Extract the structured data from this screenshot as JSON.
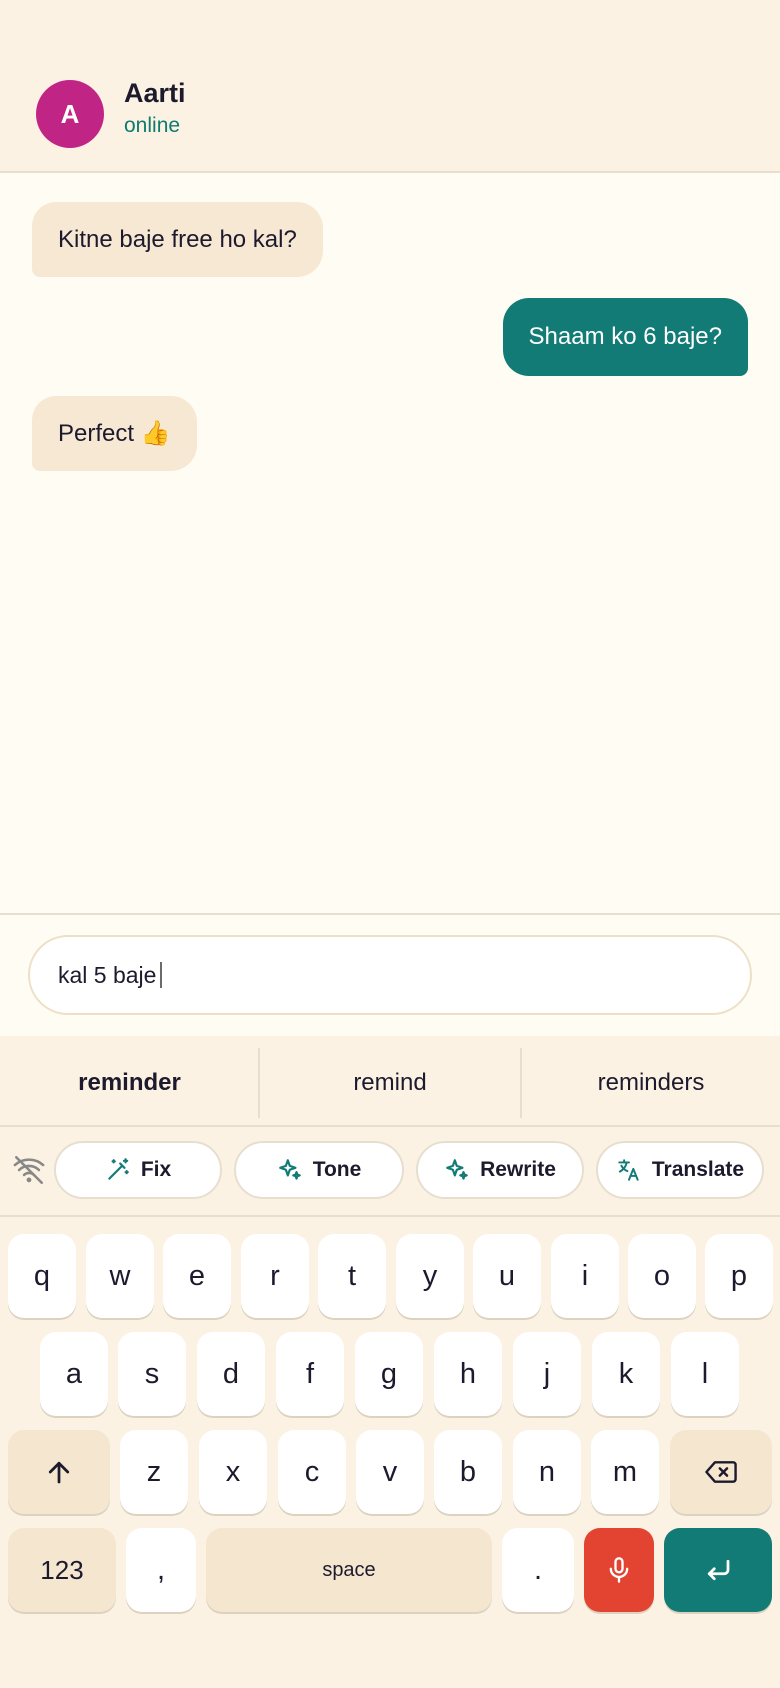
{
  "contact": {
    "initial": "A",
    "name": "Aarti",
    "status": "online"
  },
  "messages": [
    {
      "direction": "in",
      "text": "Kitne baje free ho kal?"
    },
    {
      "direction": "out",
      "text": "Shaam ko 6 baje?"
    },
    {
      "direction": "in",
      "text": "Perfect 👍"
    }
  ],
  "composer": {
    "value": "kal 5 baje"
  },
  "suggestions": [
    "reminder",
    "remind",
    "reminders"
  ],
  "tools": {
    "fix": "Fix",
    "tone": "Tone",
    "rewrite": "Rewrite",
    "translate": "Translate"
  },
  "keys": {
    "row1": [
      "q",
      "w",
      "e",
      "r",
      "t",
      "y",
      "u",
      "i",
      "o",
      "p"
    ],
    "row2": [
      "a",
      "s",
      "d",
      "f",
      "g",
      "h",
      "j",
      "k",
      "l"
    ],
    "row3": [
      "z",
      "x",
      "c",
      "v",
      "b",
      "n",
      "m"
    ],
    "numbers": "123",
    "comma": ",",
    "space": "space",
    "period": "."
  },
  "colors": {
    "accent": "#137b76",
    "avatar": "#c02586",
    "mic": "#e24431",
    "incoming_bubble": "#f7e8d4"
  },
  "icons": [
    "wifi-off-icon",
    "magic-wand-icon",
    "sparkle-icon",
    "translate-icon",
    "shift-arrow-icon",
    "backspace-icon",
    "microphone-icon",
    "enter-icon"
  ]
}
